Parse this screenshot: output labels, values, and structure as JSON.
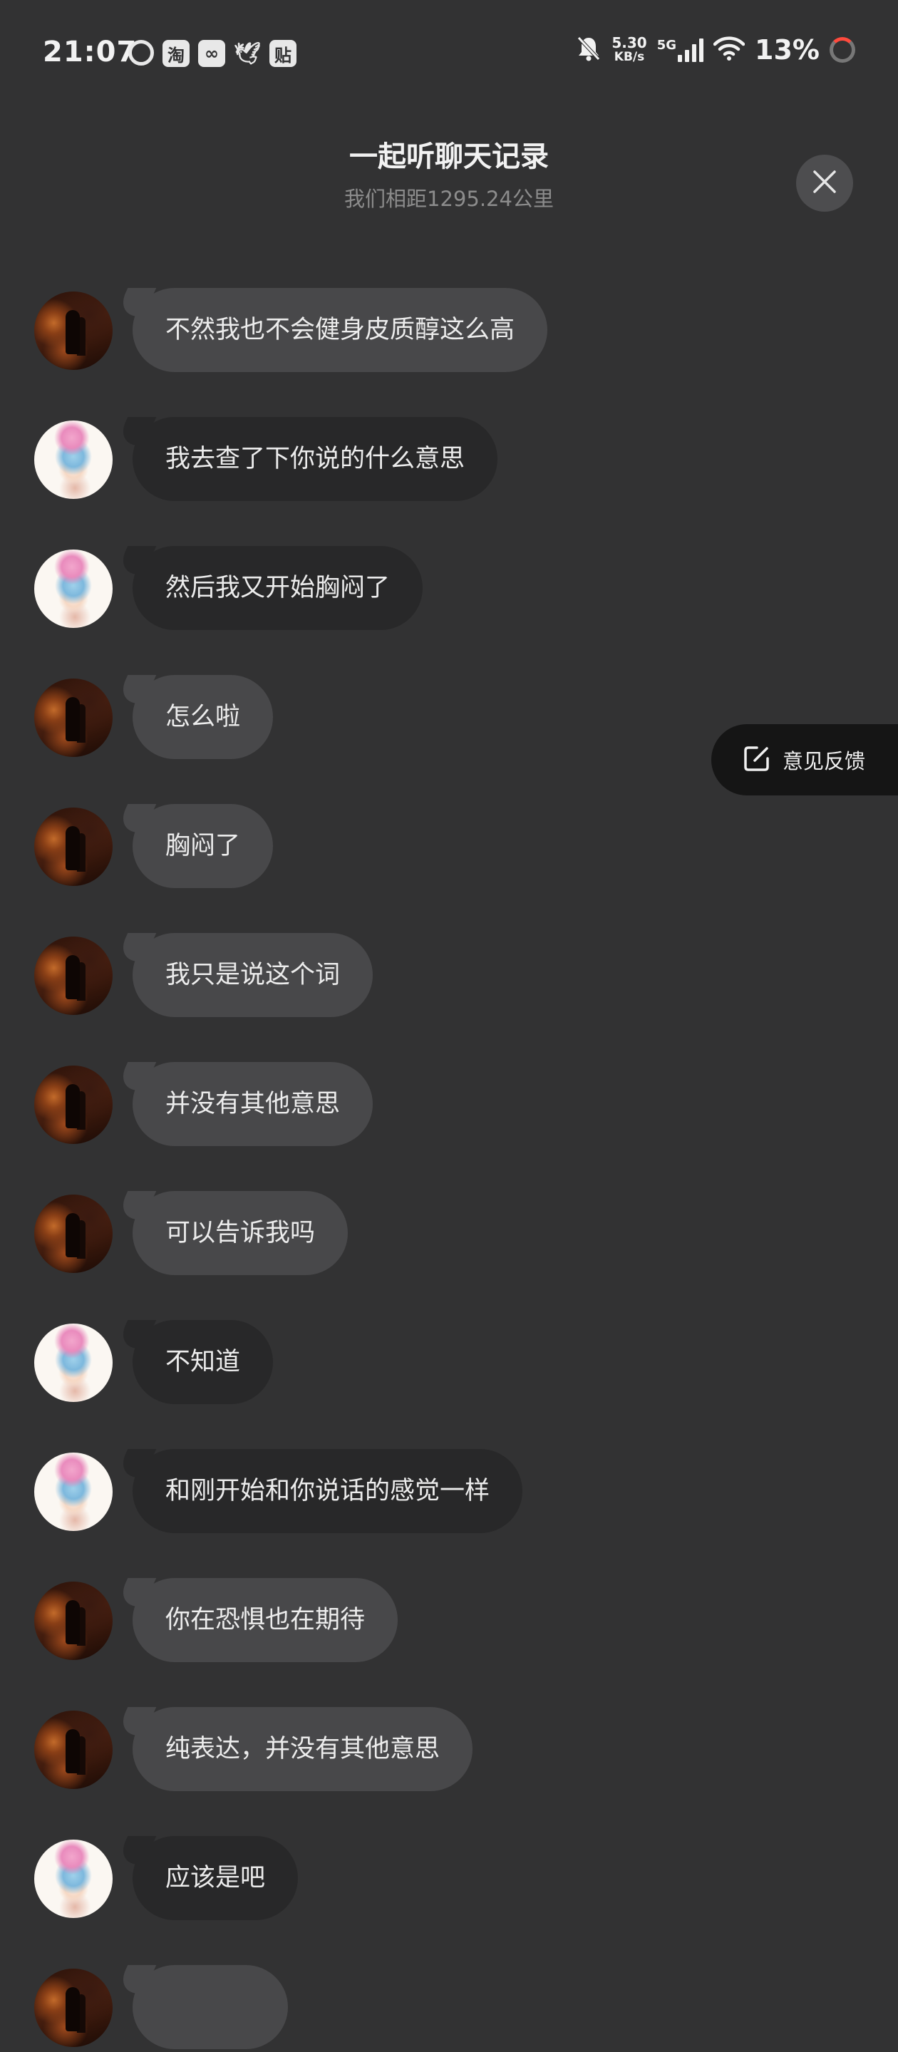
{
  "status_bar": {
    "time": "21:07",
    "notifications": [
      "netease-music-icon",
      "taobao-icon",
      "game-icon",
      "bird-icon",
      "tieba-icon"
    ],
    "notification_glyphs": [
      "",
      "淘",
      "∞",
      "🕊",
      "贴"
    ],
    "speed_value": "5.30",
    "speed_unit": "KB/s",
    "network": "5G",
    "battery": "13%",
    "battery_ring_color": "#ff4a3d"
  },
  "header": {
    "title": "一起听聊天记录",
    "subtitle": "我们相距1295.24公里"
  },
  "feedback": {
    "label": "意见反馈"
  },
  "colors": {
    "background": "#323233",
    "bubble_other": "#48484a",
    "bubble_self": "#282829",
    "feedback_bg": "#151515",
    "close_bg": "#4d4d4f"
  },
  "messages": [
    {
      "avatar": "dark",
      "style": "light",
      "text": "不然我也不会健身皮质醇这么高"
    },
    {
      "avatar": "anime",
      "style": "dark",
      "text": "我去查了下你说的什么意思"
    },
    {
      "avatar": "anime",
      "style": "dark",
      "text": "然后我又开始胸闷了"
    },
    {
      "avatar": "dark",
      "style": "light",
      "text": "怎么啦"
    },
    {
      "avatar": "dark",
      "style": "light",
      "text": "胸闷了"
    },
    {
      "avatar": "dark",
      "style": "light",
      "text": "我只是说这个词"
    },
    {
      "avatar": "dark",
      "style": "light",
      "text": "并没有其他意思"
    },
    {
      "avatar": "dark",
      "style": "light",
      "text": "可以告诉我吗"
    },
    {
      "avatar": "anime",
      "style": "dark",
      "text": "不知道"
    },
    {
      "avatar": "anime",
      "style": "dark",
      "text": "和刚开始和你说话的感觉一样"
    },
    {
      "avatar": "dark",
      "style": "light",
      "text": "你在恐惧也在期待"
    },
    {
      "avatar": "dark",
      "style": "light",
      "text": "纯表达，并没有其他意思"
    },
    {
      "avatar": "anime",
      "style": "dark",
      "text": "应该是吧"
    },
    {
      "avatar": "dark",
      "style": "light",
      "text": ""
    }
  ]
}
